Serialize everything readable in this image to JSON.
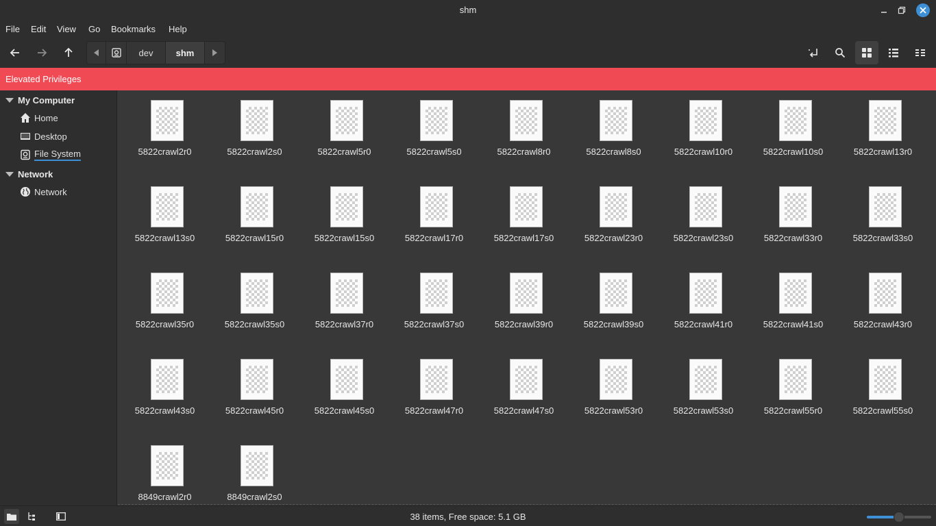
{
  "window": {
    "title": "shm"
  },
  "menubar": {
    "items": [
      "File",
      "Edit",
      "View",
      "Go",
      "Bookmarks",
      "Help"
    ]
  },
  "pathbar": {
    "segments": [
      "dev",
      "shm"
    ]
  },
  "banner": {
    "text": "Elevated Privileges",
    "color": "#f04b55"
  },
  "sidebar": {
    "sections": [
      {
        "label": "My Computer",
        "items": [
          {
            "label": "Home",
            "icon": "home-icon"
          },
          {
            "label": "Desktop",
            "icon": "desktop-icon"
          },
          {
            "label": "File System",
            "icon": "drive-icon",
            "selected": true
          }
        ]
      },
      {
        "label": "Network",
        "items": [
          {
            "label": "Network",
            "icon": "globe-icon"
          }
        ]
      }
    ]
  },
  "files": [
    "5822crawl2r0",
    "5822crawl2s0",
    "5822crawl5r0",
    "5822crawl5s0",
    "5822crawl8r0",
    "5822crawl8s0",
    "5822crawl10r0",
    "5822crawl10s0",
    "5822crawl13r0",
    "5822crawl13s0",
    "5822crawl15r0",
    "5822crawl15s0",
    "5822crawl17r0",
    "5822crawl17s0",
    "5822crawl23r0",
    "5822crawl23s0",
    "5822crawl33r0",
    "5822crawl33s0",
    "5822crawl35r0",
    "5822crawl35s0",
    "5822crawl37r0",
    "5822crawl37s0",
    "5822crawl39r0",
    "5822crawl39s0",
    "5822crawl41r0",
    "5822crawl41s0",
    "5822crawl43r0",
    "5822crawl43s0",
    "5822crawl45r0",
    "5822crawl45s0",
    "5822crawl47r0",
    "5822crawl47s0",
    "5822crawl53r0",
    "5822crawl53s0",
    "5822crawl55r0",
    "5822crawl55s0",
    "8849crawl2r0",
    "8849crawl2s0"
  ],
  "status": {
    "text": "38 items, Free space: 5.1 GB",
    "zoom_level": 0.5
  },
  "colors": {
    "accent": "#3d8fd6"
  }
}
